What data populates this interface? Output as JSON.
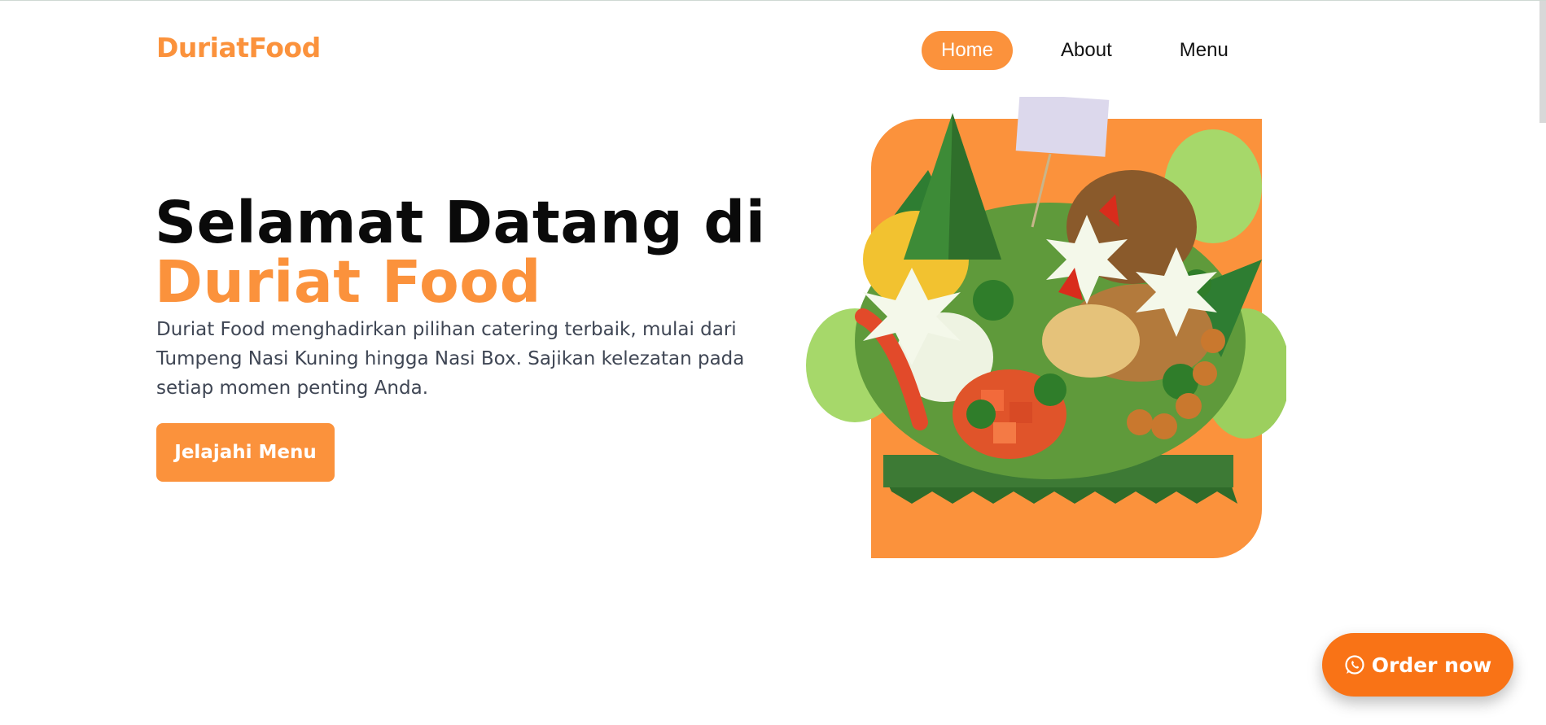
{
  "header": {
    "logo": "DuriatFood",
    "nav": [
      {
        "label": "Home",
        "active": true
      },
      {
        "label": "About",
        "active": false
      },
      {
        "label": "Menu",
        "active": false
      }
    ]
  },
  "hero": {
    "title_line1": "Selamat Datang di",
    "title_line2": "Duriat Food",
    "description": "Duriat Food menghadirkan pilihan catering terbaik, mulai dari Tumpeng Nasi Kuning hingga Nasi Box. Sajikan kelezatan pada setiap momen penting Anda.",
    "cta_label": "Jelajahi Menu",
    "image_icon": "tumpeng-food-image"
  },
  "floating": {
    "order_label": "Order now",
    "order_icon": "whatsapp-icon"
  },
  "colors": {
    "accent": "#fb923c",
    "order": "#f97316",
    "text": "#0a0a0a",
    "muted": "#3f4654"
  }
}
